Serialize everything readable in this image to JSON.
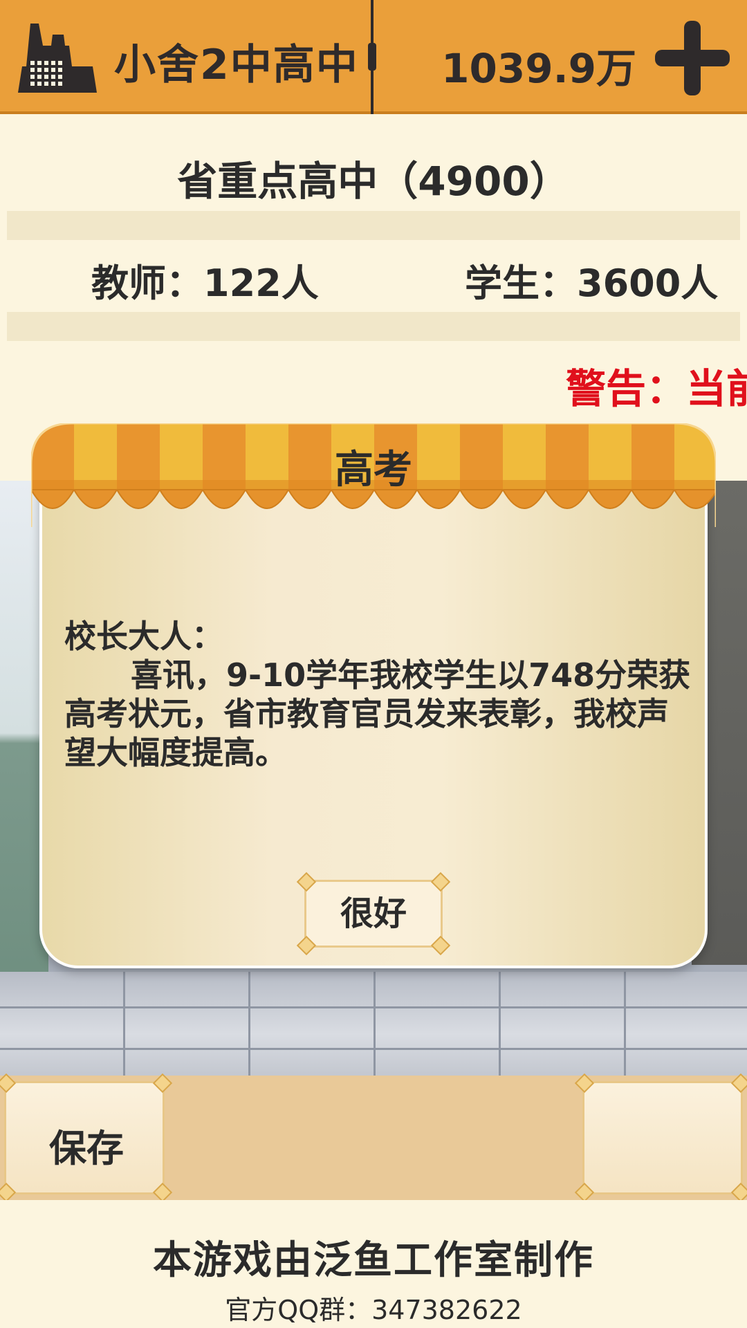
{
  "header": {
    "school_name": "小舍2中高中",
    "money": "1039.9万",
    "add_icon": "plus-icon",
    "school_icon": "factory-building-icon"
  },
  "info": {
    "level": "省重点高中（4900）",
    "teachers_label": "教师：",
    "teachers_value": "122人",
    "students_label": "学生：",
    "students_value": "3600人",
    "warning": "警告：当前"
  },
  "dialog": {
    "title": "高考",
    "greeting": "校长大人：",
    "message": "喜讯，9-10学年我校学生以748分荣获高考状元，省市教育官员发来表彰，我校声望大幅度提高。",
    "ok_label": "很好"
  },
  "toolbar": {
    "save_label": "保存"
  },
  "footer": {
    "credits": "本游戏由泛鱼工作室制作",
    "qq_group": "官方QQ群：347382622"
  },
  "colors": {
    "header_bg": "#ea9f3a",
    "panel_bg": "#fcf5df",
    "warning_text": "#e0101c",
    "toolbar_bg": "#e9c998",
    "awning_orange": "#e8952f",
    "awning_yellow": "#f0bb3c"
  }
}
